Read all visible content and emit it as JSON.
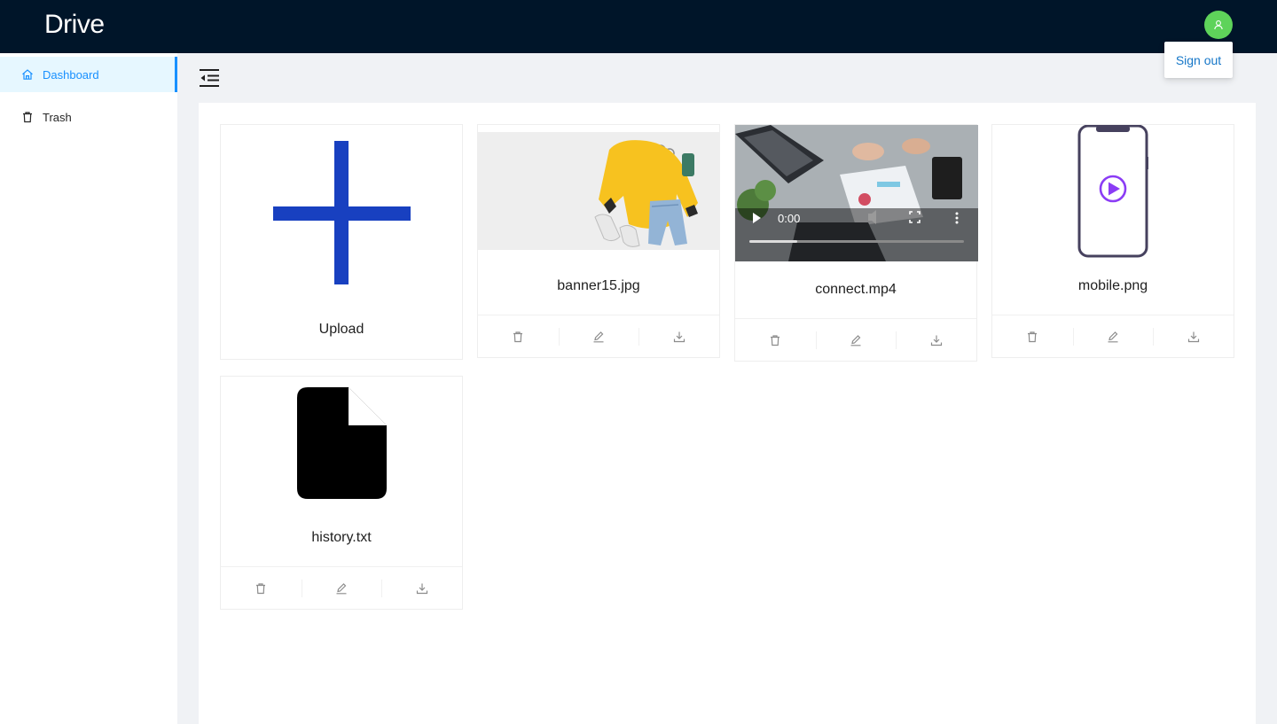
{
  "app": {
    "title": "Drive"
  },
  "header": {
    "avatar_icon": "user-icon",
    "avatar_color": "#5ed35a"
  },
  "menu": {
    "sign_out": "Sign out"
  },
  "sidebar": {
    "items": [
      {
        "label": "Dashboard",
        "icon": "home-icon",
        "active": true
      },
      {
        "label": "Trash",
        "icon": "trash-icon",
        "active": false
      }
    ]
  },
  "upload": {
    "label": "Upload",
    "icon": "plus-icon",
    "color": "#1840c0"
  },
  "files": [
    {
      "name": "banner15.jpg",
      "type": "image"
    },
    {
      "name": "connect.mp4",
      "type": "video",
      "time": "0:00"
    },
    {
      "name": "mobile.png",
      "type": "image"
    },
    {
      "name": "history.txt",
      "type": "text"
    }
  ],
  "colors": {
    "header_bg": "#001529",
    "accent": "#1890ff",
    "content_bg": "#f0f2f5"
  }
}
